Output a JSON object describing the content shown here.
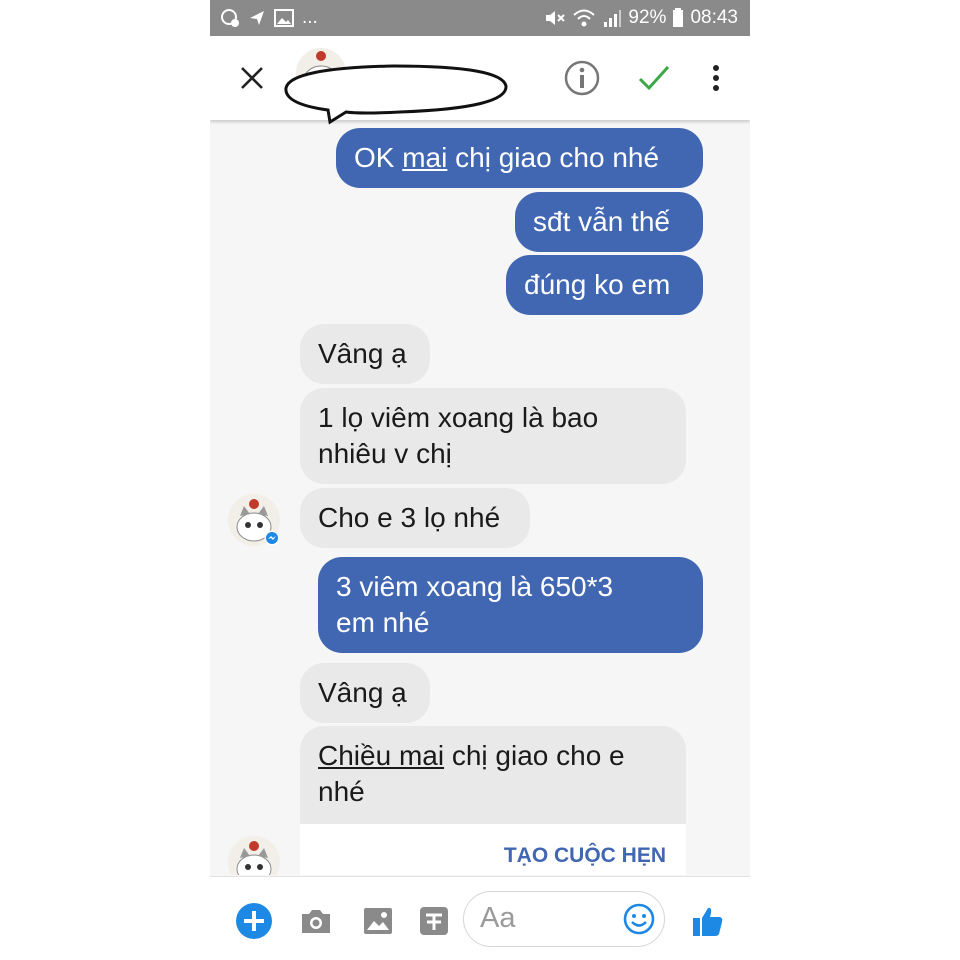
{
  "status_bar": {
    "more_indicator": "...",
    "battery_percent": "92%",
    "time": "08:43"
  },
  "header": {
    "close_icon": "close-icon",
    "info_icon": "info-icon",
    "confirm_icon": "check-icon",
    "menu_icon": "more-vertical-icon",
    "accent_color": "#4267b2",
    "check_color": "#3aa845"
  },
  "messages": [
    {
      "dir": "out",
      "text": "OK mai chị giao cho nhé",
      "underlined": "mai"
    },
    {
      "dir": "out",
      "text": "sđt vẫn thế"
    },
    {
      "dir": "out",
      "text": "đúng ko em"
    },
    {
      "dir": "in",
      "text": "Vâng ạ"
    },
    {
      "dir": "in",
      "lines": [
        "1 lọ viêm xoang là bao",
        "nhiêu v chị"
      ]
    },
    {
      "dir": "in",
      "text": "Cho e 3 lọ nhé"
    },
    {
      "dir": "out",
      "lines": [
        "3 viêm xoang là 650*3",
        "em nhé"
      ]
    },
    {
      "dir": "in",
      "text": "Vâng ạ"
    },
    {
      "dir": "in",
      "lines": [
        "Chiều mai chị giao cho e",
        "nhé"
      ],
      "underlined": "Chiều mai"
    }
  ],
  "msg": {
    "m1_pre": "OK ",
    "m1_u": "mai",
    "m1_post": " chị giao cho nhé",
    "m2": "sđt vẫn thế",
    "m3": "đúng ko em",
    "m4": "Vâng ạ",
    "m5_l1": "1 lọ viêm xoang là bao",
    "m5_l2": "nhiêu v chị",
    "m6": "Cho e 3 lọ nhé",
    "m7_l1": "3 viêm xoang là 650*3",
    "m7_l2": "em nhé",
    "m8": "Vâng ạ",
    "m9_u": "Chiều mai",
    "m9_post": " chị giao cho e",
    "m9_l2": "nhé",
    "action": "TẠO CUỘC HẸN"
  },
  "composer": {
    "placeholder": "Aa",
    "icons": [
      "plus-icon",
      "camera-icon",
      "image-icon",
      "gif-icon",
      "emoji-icon",
      "like-icon"
    ]
  }
}
